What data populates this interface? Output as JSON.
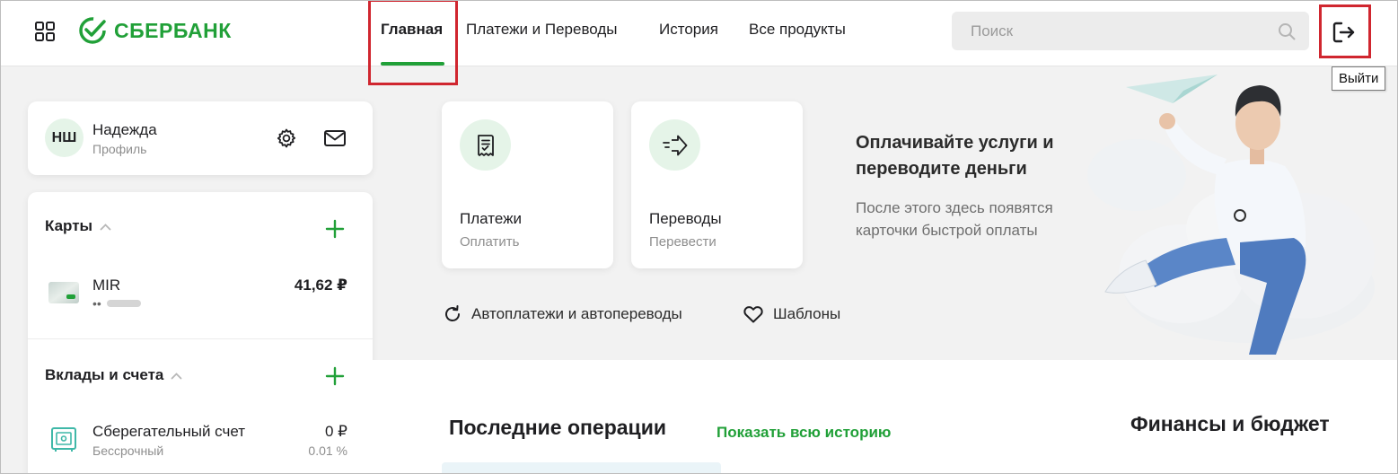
{
  "header": {
    "logo_text": "СБЕРБАНК",
    "nav": [
      {
        "label": "Главная",
        "active": true
      },
      {
        "label": "Платежи и Переводы",
        "active": false
      },
      {
        "label": "История",
        "active": false
      },
      {
        "label": "Все продукты",
        "active": false
      }
    ],
    "search_placeholder": "Поиск",
    "logout_tooltip": "Выйти"
  },
  "profile": {
    "initials": "НШ",
    "name": "Надежда",
    "subtitle": "Профиль"
  },
  "cards_section": {
    "title": "Карты",
    "items": [
      {
        "name": "MIR",
        "number_mask": "••",
        "amount": "41,62 ₽"
      }
    ]
  },
  "deposits_section": {
    "title": "Вклады и счета",
    "items": [
      {
        "name": "Сберегательный счет",
        "subtitle": "Бессрочный",
        "amount": "0 ₽",
        "rate": "0.01 %"
      }
    ]
  },
  "quick_actions": [
    {
      "title": "Платежи",
      "subtitle": "Оплатить",
      "icon": "receipt-icon"
    },
    {
      "title": "Переводы",
      "subtitle": "Перевести",
      "icon": "transfer-arrow-icon"
    }
  ],
  "promo": {
    "title": "Оплачивайте услуги и переводите деньги",
    "text": "После этого здесь появятся карточки быстрой оплаты"
  },
  "links": {
    "autopay": "Автоплатежи и автопереводы",
    "templates": "Шаблоны"
  },
  "recent_ops": {
    "title": "Последние операции",
    "show_all": "Показать всю историю"
  },
  "finance": {
    "title": "Финансы и бюджет"
  },
  "colors": {
    "brand_green": "#21a038",
    "highlight_red": "#d0262f",
    "background": "#f2f2f2"
  }
}
